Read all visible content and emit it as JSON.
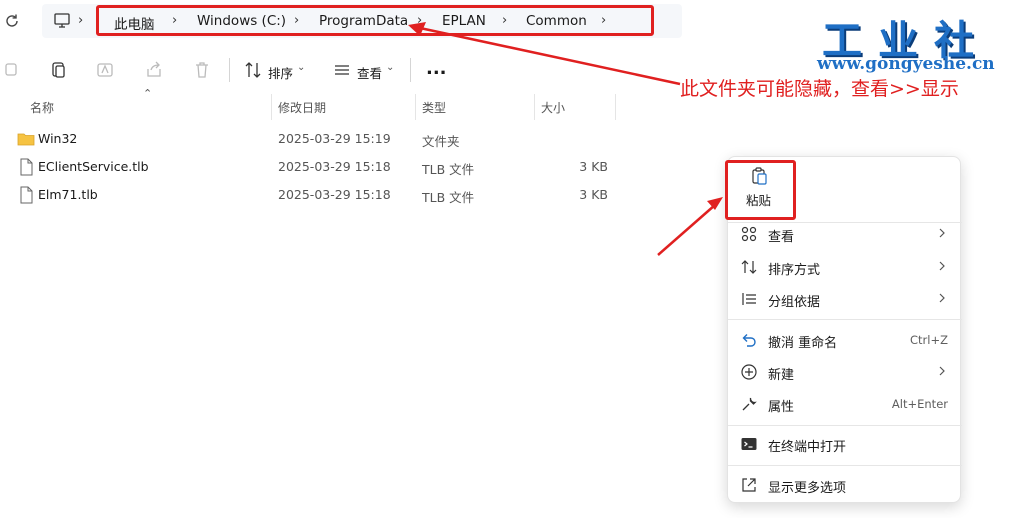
{
  "address_bar": {
    "breadcrumbs": [
      "此电脑",
      "Windows (C:)",
      "ProgramData",
      "EPLAN",
      "Common"
    ]
  },
  "toolbar": {
    "sort_label": "排序",
    "view_label": "查看",
    "more_label": "..."
  },
  "columns": {
    "name": "名称",
    "date": "修改日期",
    "type": "类型",
    "size": "大小"
  },
  "files": [
    {
      "name": "Win32",
      "date": "2025-03-29 15:19",
      "type": "文件夹",
      "size": "",
      "icon": "folder-icon"
    },
    {
      "name": "EClientService.tlb",
      "date": "2025-03-29 15:18",
      "type": "TLB 文件",
      "size": "3 KB",
      "icon": "file-icon"
    },
    {
      "name": "Elm71.tlb",
      "date": "2025-03-29 15:18",
      "type": "TLB 文件",
      "size": "3 KB",
      "icon": "file-icon"
    }
  ],
  "context_menu": {
    "paste": "粘贴",
    "items": [
      {
        "label": "查看",
        "shortcut": "",
        "submenu": true,
        "icon": "grid-icon"
      },
      {
        "label": "排序方式",
        "shortcut": "",
        "submenu": true,
        "icon": "sort-icon"
      },
      {
        "label": "分组依据",
        "shortcut": "",
        "submenu": true,
        "icon": "group-icon"
      },
      {
        "label": "撤消 重命名",
        "shortcut": "Ctrl+Z",
        "submenu": false,
        "icon": "undo-icon"
      },
      {
        "label": "新建",
        "shortcut": "",
        "submenu": true,
        "icon": "new-icon"
      },
      {
        "label": "属性",
        "shortcut": "Alt+Enter",
        "submenu": false,
        "icon": "wrench-icon"
      },
      {
        "label": "在终端中打开",
        "shortcut": "",
        "submenu": false,
        "icon": "terminal-icon"
      },
      {
        "label": "显示更多选项",
        "shortcut": "",
        "submenu": false,
        "icon": "share-icon"
      }
    ]
  },
  "annotation": {
    "note": "此文件夹可能隐藏，查看>>显示",
    "logo_text": "工业社",
    "logo_url": "www.gongyeshe.cn",
    "color": "#e02020"
  },
  "colors": {
    "accent": "#1f6fc5",
    "highlight": "#e02020",
    "folder": "#f6c342"
  }
}
